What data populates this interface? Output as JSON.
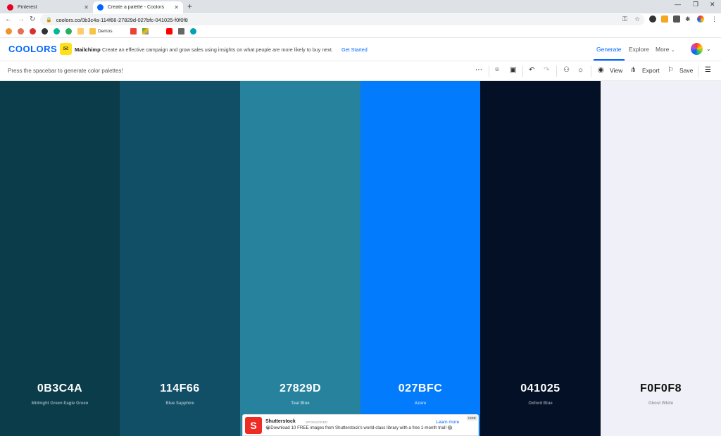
{
  "browser": {
    "tabs": [
      {
        "title": "Pinterest",
        "favicon_color": "#e60023",
        "active": false
      },
      {
        "title": "Create a palette - Coolors",
        "favicon_color": "#0066ff",
        "active": true
      }
    ],
    "url": "coolors.co/0b3c4a-114f66-27829d-027bfc-041025-f0f0f8",
    "bookmarks": {
      "demos_label": "Demos"
    }
  },
  "header": {
    "logo": "COOLORS",
    "promo": {
      "icon_glyph": "✉",
      "brand": "Mailchimp",
      "text": "Create an effective campaign and grow sales using insights on what people are more likely to buy next.",
      "link": "Get Started"
    },
    "nav": {
      "generate": "Generate",
      "explore": "Explore",
      "more": "More"
    }
  },
  "toolbar": {
    "hint": "Press the spacebar to generate color palettes!",
    "view_label": "View",
    "export_label": "Export",
    "save_label": "Save"
  },
  "palette": [
    {
      "hex": "0B3C4A",
      "name": "Midnight Green Eagle Green",
      "color": "#0b3c4a",
      "text_color": "#ffffff",
      "name_color": "#8fa9b0"
    },
    {
      "hex": "114F66",
      "name": "Blue Sapphire",
      "color": "#114f66",
      "text_color": "#ffffff",
      "name_color": "#9bb4bf"
    },
    {
      "hex": "27829D",
      "name": "Teal Blue",
      "color": "#27829d",
      "text_color": "#ffffff",
      "name_color": "#b3d2dc"
    },
    {
      "hex": "027BFC",
      "name": "Azure",
      "color": "#027bfc",
      "text_color": "#ffffff",
      "name_color": "#b3d4fe"
    },
    {
      "hex": "041025",
      "name": "Oxford Blue",
      "color": "#041025",
      "text_color": "#ffffff",
      "name_color": "#8a91a0"
    },
    {
      "hex": "F0F0F8",
      "name": "Ghost White",
      "color": "#f0f0f8",
      "text_color": "#111111",
      "name_color": "#9a9aa3"
    }
  ],
  "ad": {
    "brand": "Shutterstock",
    "sponsored": "SPONSORED",
    "text": "😭Download 10 FREE images from Shutterstock's world-class library with a free 1-month trial! 😱",
    "learn_more": "Learn more",
    "hide": "HIDE"
  }
}
